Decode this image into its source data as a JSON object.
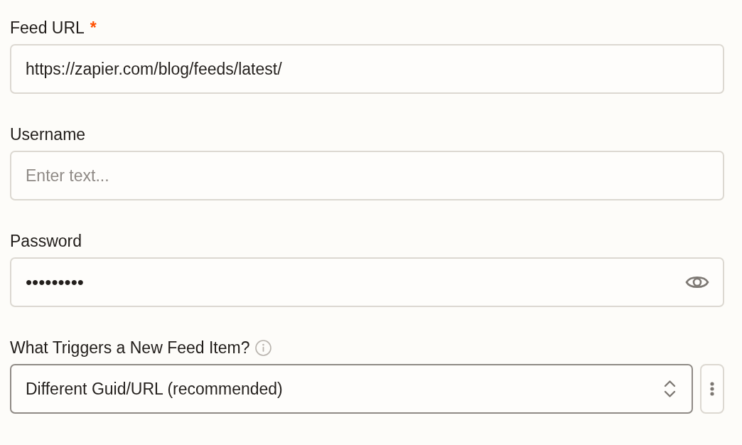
{
  "fields": [
    {
      "kind": "text",
      "label": "Feed URL",
      "required_mark": "*",
      "value": "https://zapier.com/blog/feeds/latest/"
    },
    {
      "kind": "text",
      "label": "Username",
      "placeholder": "Enter text..."
    },
    {
      "kind": "password",
      "label": "Password",
      "value": "•••••••••"
    },
    {
      "kind": "select",
      "label": "What Triggers a New Feed Item?",
      "info": true,
      "value": "Different Guid/URL (recommended)"
    }
  ]
}
